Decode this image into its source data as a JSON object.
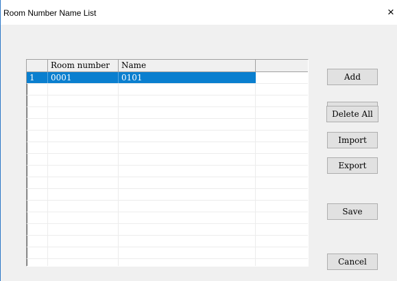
{
  "window": {
    "title": "Room Number Name List",
    "close_glyph": "×"
  },
  "list": {
    "columns": [
      "",
      "Room number",
      "Name"
    ],
    "rows": [
      {
        "index": "1",
        "room_number": "0001",
        "name": "0101",
        "selected": true
      }
    ]
  },
  "buttons": {
    "add": "Add",
    "delete": "Delete",
    "delete_all": "Delete All",
    "import": "Import",
    "export": "Export",
    "save": "Save",
    "cancel": "Cancel"
  },
  "colors": {
    "selection": "#0a7fcf",
    "dialog_bg": "#f0f0f0",
    "window_border": "#2b77c7"
  }
}
